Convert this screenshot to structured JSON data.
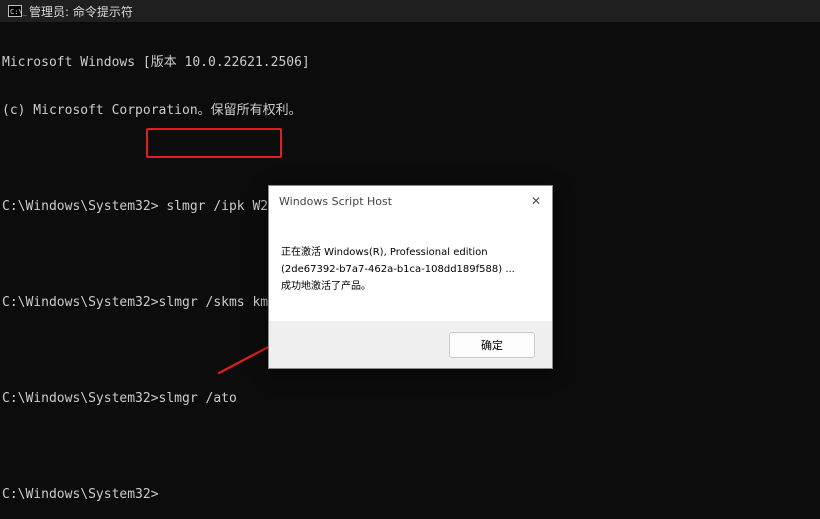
{
  "window": {
    "title": "管理员: 命令提示符",
    "icon": "cmd-icon",
    "icon_text": "C:\\_"
  },
  "console": {
    "lines": [
      "Microsoft Windows [版本 10.0.22621.2506]",
      "(c) Microsoft Corporation。保留所有权利。",
      "",
      "C:\\Windows\\System32> slmgr /ipk W269N-WFGWX-YVC9B-4J6C9-T83GX",
      "",
      "C:\\Windows\\System32>slmgr /skms kms8.msguides.com",
      "",
      "C:\\Windows\\System32>slmgr /ato",
      "",
      "C:\\Windows\\System32>"
    ]
  },
  "colors": {
    "highlight": "#e01e1e",
    "arrow": "#e01e1e"
  },
  "dialog": {
    "title": "Windows Script Host",
    "message": [
      "正在激活 Windows(R), Professional edition",
      "(2de67392-b7a7-462a-b1ca-108dd189f588) ...",
      "成功地激活了产品。"
    ],
    "ok_label": "确定",
    "close_icon": "close-icon"
  }
}
